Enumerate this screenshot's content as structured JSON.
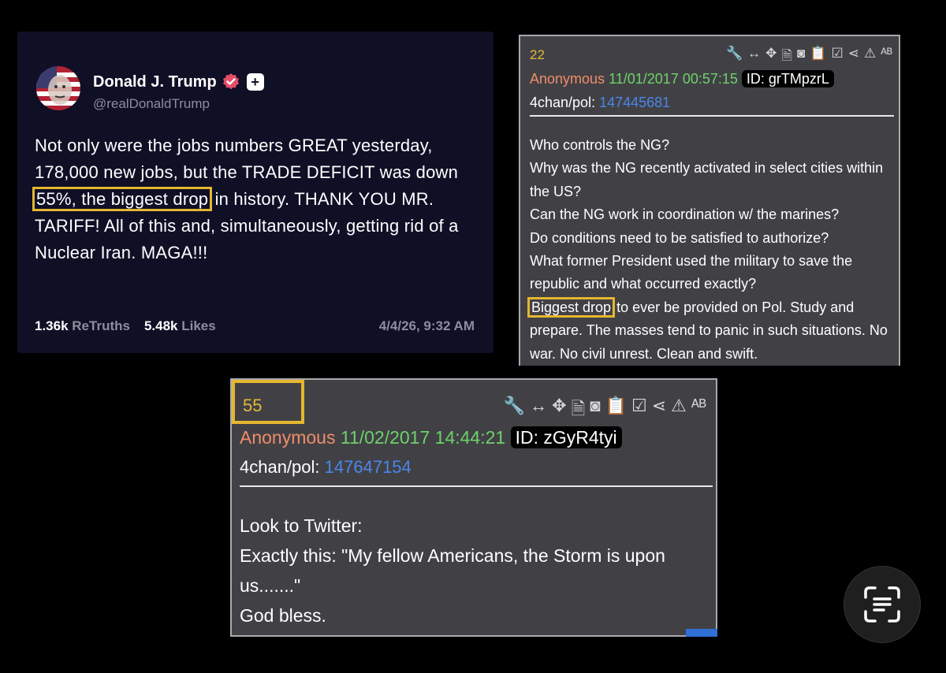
{
  "truth_post": {
    "author_name": "Donald J. Trump",
    "handle": "@realDonaldTrump",
    "text_before": "Not only were the jobs numbers GREAT yesterday, 178,000 new jobs, but the TRADE DEFICIT was down",
    "highlighted": "55%, the biggest drop",
    "text_after": "in history. THANK YOU MR. TARIFF! All of this and, simultaneously, getting rid of a Nuclear Iran. MAGA!!!",
    "retruths_count": "1.36k",
    "retruths_label": "ReTruths",
    "likes_count": "5.48k",
    "likes_label": "Likes",
    "timestamp": "4/4/26, 9:32 AM",
    "plus_symbol": "+"
  },
  "q_post_22": {
    "number": "22",
    "author": "Anonymous",
    "date": "11/01/2017 00:57:15",
    "id": "ID: grTMpzrL",
    "board": "4chan/pol:",
    "post_link": "147445681",
    "lines": [
      "Who controls the NG?",
      "Why was the NG recently activated in select cities within the US?",
      "Can the NG work in coordination w/ the marines?",
      "Do conditions need to be satisfied to authorize?",
      "What former President used the military to save the republic and what occurred exactly?"
    ],
    "highlighted": "Biggest drop",
    "last_after": "to ever be provided on Pol. Study and prepare. The masses tend to panic in such situations. No war. No civil unrest. Clean and swift."
  },
  "q_post_55": {
    "number": "55",
    "author": "Anonymous",
    "date": "11/02/2017 14:44:21",
    "id": "ID: zGyR4tyi",
    "board": "4chan/pol:",
    "post_link": "147647154",
    "lines": [
      "Look to Twitter:",
      "Exactly this: \"My fellow Americans, the Storm is upon us.......\"",
      "God bless."
    ]
  },
  "toolbar_icons": [
    "wrench-icon",
    "resize-horizontal-icon",
    "move-icon",
    "document-icon",
    "vr-goggles-icon",
    "clipboard-icon",
    "clipboard-check-icon",
    "share-icon",
    "warning-icon",
    "spellcheck-icon"
  ],
  "toolbar_glyphs": [
    "🔧",
    "↔",
    "✥",
    "🗎",
    "◙",
    "📋",
    "☑",
    "⋖",
    "⚠",
    "ᴬᴮ"
  ],
  "colors": {
    "highlight": "#e5b62f",
    "q_number": "#e2b93b",
    "anonymous": "#f08c6a",
    "date": "#6ed16a",
    "link": "#4a86e8",
    "truth_bg": "#0f0f26",
    "verified_badge": "#e44d68"
  }
}
